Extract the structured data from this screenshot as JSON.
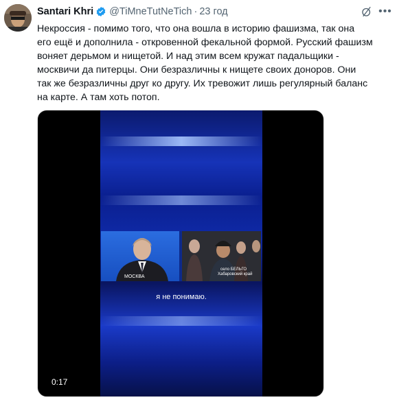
{
  "tweet": {
    "author_name": "Santari Khri",
    "handle": "@TiMneTutNeTich",
    "separator": "·",
    "time": "23 год",
    "text": "Некроссия - помимо того, что она вошла в историю фашизма, так она\nего ещё и дополнила - откровенной фекальной формой. Русский фашизм\nвоняет дерьмом и нищетой. И над этим всем кружат падальщики -\nмосквичи да питерцы. Они безразличны к нищете своих доноров. Они\nтак же безразличны друг ко другу. Их тревожит лишь регулярный баланс\nна карте. А там хоть потоп."
  },
  "icons": {
    "verified": "verified-badge-icon",
    "grok": "grok-icon",
    "more": "more-icon"
  },
  "video": {
    "left_location": "МОСКВА",
    "right_location_line1": "село БЕЛЬГО",
    "right_location_line2": "Хабаровский край",
    "subtitle": "я не понимаю.",
    "timestamp": "0:17"
  },
  "colors": {
    "verified_blue": "#1d9bf0",
    "secondary_text": "#536471",
    "primary_text": "#0f1419"
  }
}
